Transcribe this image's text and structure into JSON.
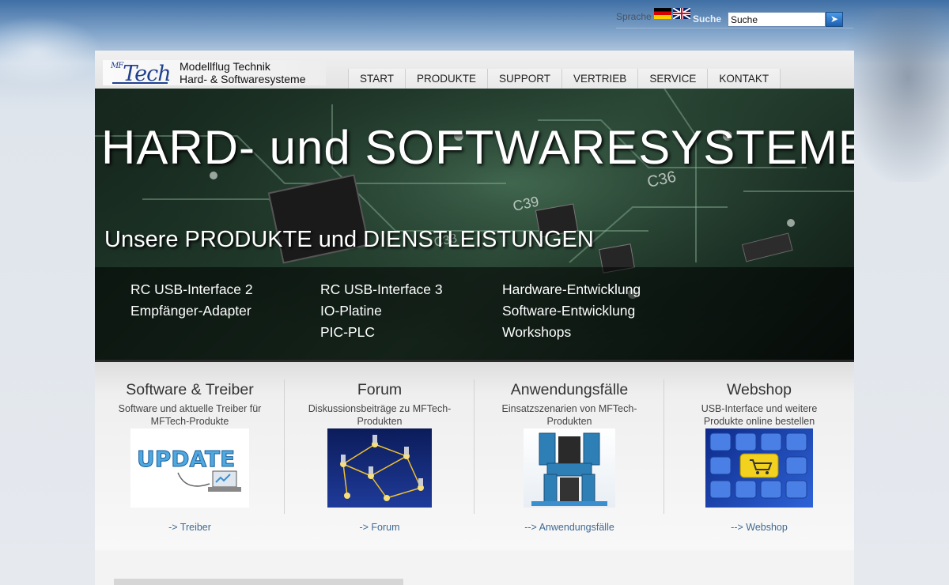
{
  "topbar": {
    "language_label": "Sprache",
    "flags": [
      "german-flag-icon",
      "english-flag-icon"
    ],
    "search_label": "Suche",
    "search_value": "Suche",
    "search_button_icon": "arrow-right-icon"
  },
  "header": {
    "logo_text": "Tech",
    "logo_prefix": "MF",
    "logo_line1": "Modellflug Technik",
    "logo_line2": "Hard- & Softwaresysteme"
  },
  "nav": {
    "items": [
      {
        "label": "START"
      },
      {
        "label": "PRODUKTE"
      },
      {
        "label": "SUPPORT"
      },
      {
        "label": "VERTRIEB"
      },
      {
        "label": "SERVICE"
      },
      {
        "label": "KONTAKT"
      }
    ]
  },
  "hero": {
    "title": "HARD- und SOFTWARESYSTEME",
    "subtitle": "Unsere PRODUKTE und DIENSTLEISTUNGEN",
    "links": [
      "RC USB-Interface 2",
      "Empfänger-Adapter",
      "RC USB-Interface 3",
      "IO-Platine",
      "PIC-PLC",
      "Hardware-Entwicklung",
      "Software-Entwicklung",
      "Workshops"
    ],
    "board_labels": [
      "C36",
      "C39",
      "C33"
    ]
  },
  "features": [
    {
      "title": "Software & Treiber",
      "desc": "Software und aktuelle Treiber für MFTech-Produkte",
      "image_text": "UPDATE",
      "link": "-> Treiber"
    },
    {
      "title": "Forum",
      "desc": "Diskussionsbeiträge zu MFTech-Produkten",
      "link": "-> Forum"
    },
    {
      "title": "Anwendungsfälle",
      "desc": "Einsatzszenarien von MFTech-Produkten",
      "link": "--> Anwendungsfälle"
    },
    {
      "title": "Webshop",
      "desc": "USB-Interface und weitere Produkte online bestellen",
      "link": "--> Webshop"
    }
  ]
}
